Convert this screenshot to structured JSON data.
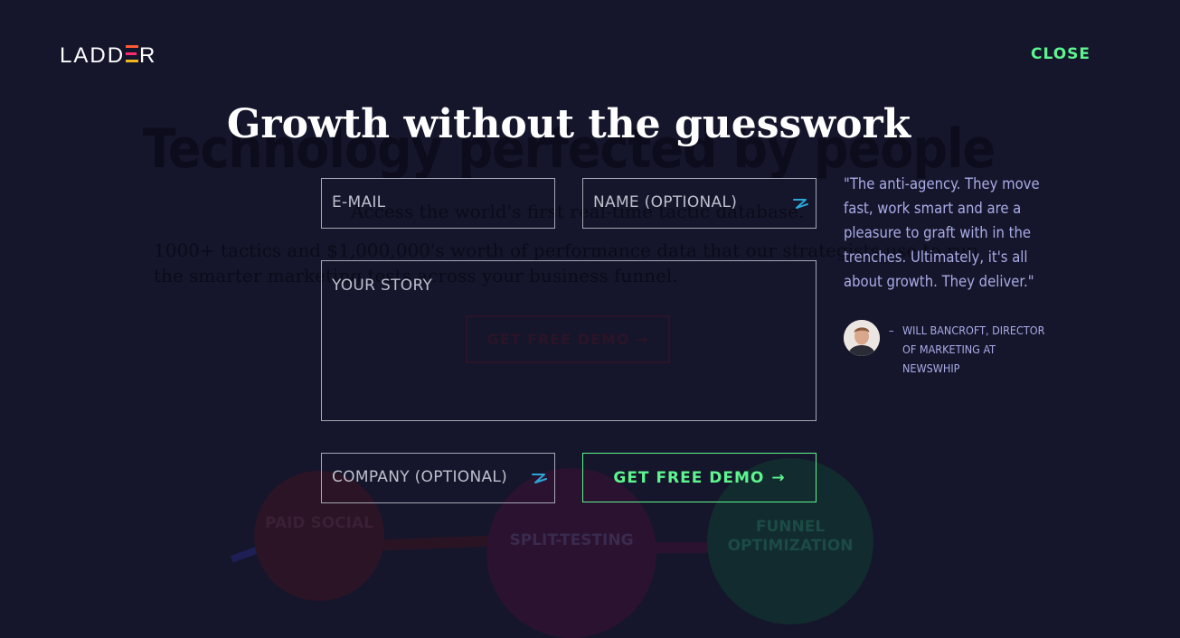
{
  "background": {
    "headline": "Technology perfected by people",
    "subline1": "Access the world's first real-time tactic database.",
    "subline2": "1000+ tactics and $1,000,000's worth of performance data that our strategists use to run the smarter marketing tests across your business funnel.",
    "cta_label": "GET FREE DEMO →",
    "circles": [
      "PAID SOCIAL",
      "SPLIT-TESTING",
      "FUNNEL OPTIMIZATION"
    ]
  },
  "header": {
    "logo_text": "LADDER",
    "close_label": "CLOSE"
  },
  "modal": {
    "title": "Growth without the guesswork"
  },
  "form": {
    "email_placeholder": "E-MAIL",
    "name_placeholder": "NAME (OPTIONAL)",
    "story_placeholder": "YOUR STORY",
    "company_placeholder": "COMPANY (OPTIONAL)",
    "submit_label": "GET FREE DEMO",
    "submit_arrow": "→"
  },
  "testimonial": {
    "quote": "\"The anti-agency. They move fast, work smart and are a pleasure to graft with in the trenches. Ultimately, it's all about growth. They deliver.\"",
    "dash": "–",
    "author": "WILL BANCROFT, DIRECTOR OF MARKETING AT NEWSWHIP"
  },
  "colors": {
    "background": "#15162b",
    "accent_green": "#5ef58f",
    "quote_text": "#a9abe6"
  },
  "icons": {
    "autofill": "autofill-icon",
    "arrow": "arrow-right-icon"
  }
}
